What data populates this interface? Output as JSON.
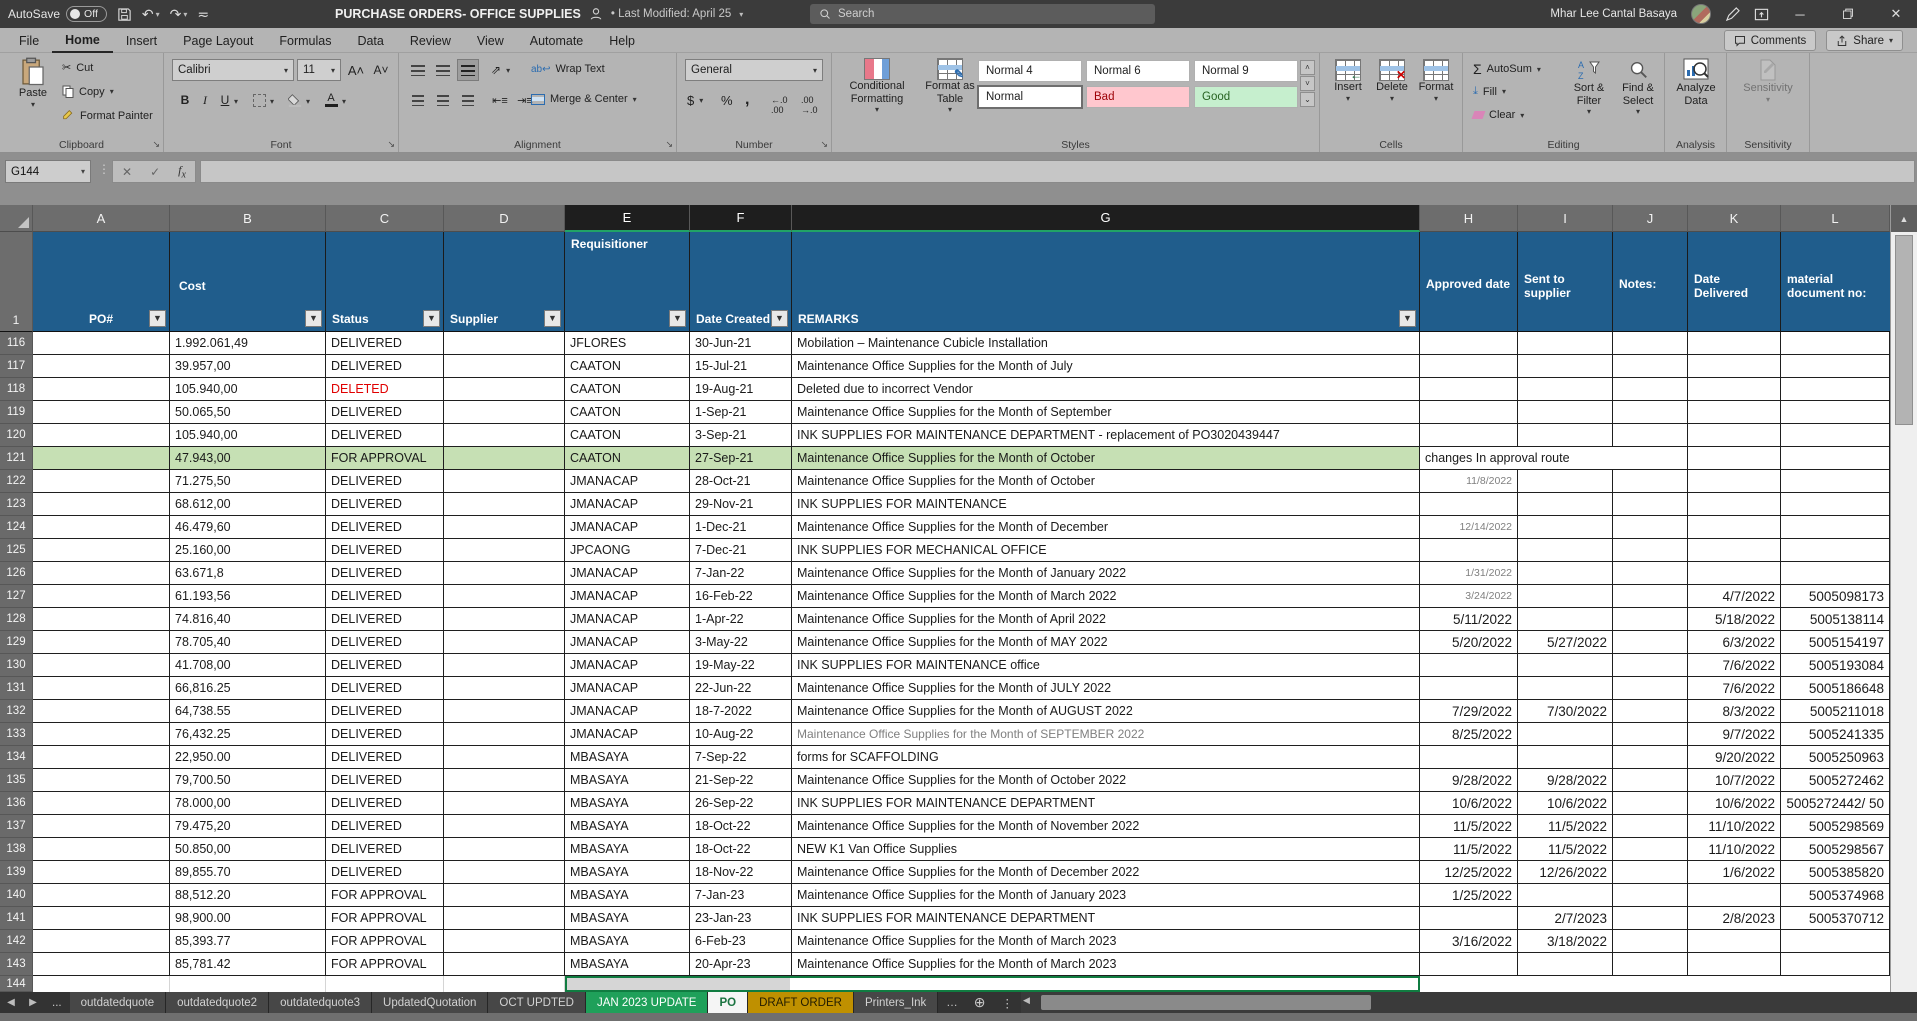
{
  "titlebar": {
    "autosave_label": "AutoSave",
    "autosave_state": "Off",
    "doc_title": "PURCHASE ORDERS- OFFICE SUPPLIES",
    "last_modified": "• Last Modified: April 25",
    "search_placeholder": "Search",
    "user_name": "Mhar Lee Cantal Basaya"
  },
  "icons": {
    "undo": "↶",
    "redo": "↷",
    "dropdown": "▾",
    "check": "✓",
    "close": "✕",
    "cut": "✂",
    "autosum": "Σ",
    "up": "▲",
    "ellipsis": "…",
    "add": "+",
    "more": "⋮",
    "left": "◀",
    "right": "▶"
  },
  "ribbon_tabs": {
    "items": [
      "File",
      "Home",
      "Insert",
      "Page Layout",
      "Formulas",
      "Data",
      "Review",
      "View",
      "Automate",
      "Help"
    ],
    "active": "Home",
    "comments": "Comments",
    "share": "Share"
  },
  "ribbon": {
    "clipboard": {
      "group": "Clipboard",
      "paste": "Paste",
      "cut": "Cut",
      "copy": "Copy",
      "format_painter": "Format Painter"
    },
    "font": {
      "group": "Font",
      "name": "Calibri",
      "size": "11"
    },
    "alignment": {
      "group": "Alignment",
      "wrap": "Wrap Text",
      "merge": "Merge & Center"
    },
    "number": {
      "group": "Number",
      "format": "General"
    },
    "styles": {
      "group": "Styles",
      "conditional": "Conditional\nFormatting",
      "format_table": "Format as\nTable",
      "chips": [
        {
          "label": "Normal 4",
          "type": "plain"
        },
        {
          "label": "Normal 6",
          "type": "plain"
        },
        {
          "label": "Normal 9",
          "type": "plain"
        },
        {
          "label": "Normal",
          "type": "selected"
        },
        {
          "label": "Bad",
          "type": "bad"
        },
        {
          "label": "Good",
          "type": "good"
        }
      ]
    },
    "cells": {
      "group": "Cells",
      "insert": "Insert",
      "delete": "Delete",
      "format": "Format"
    },
    "editing": {
      "group": "Editing",
      "autosum": "AutoSum",
      "fill": "Fill",
      "clear": "Clear",
      "sort": "Sort &\nFilter",
      "find": "Find &\nSelect"
    },
    "analysis": {
      "group": "Analysis",
      "analyze": "Analyze\nData"
    },
    "sensitivity": {
      "group": "Sensitivity",
      "button": "Sensitivity"
    }
  },
  "formula_bar": {
    "name_box": "G144",
    "formula": ""
  },
  "grid": {
    "columns": [
      "A",
      "B",
      "C",
      "D",
      "E",
      "F",
      "G",
      "H",
      "I",
      "J",
      "K",
      "L"
    ],
    "selected_columns": [
      "E",
      "F",
      "G"
    ],
    "header": {
      "po": "PO#",
      "cost": "Cost",
      "status": "Status",
      "supplier": "Supplier",
      "requisitioner": "Requisitioner",
      "date_created": "Date Created",
      "remarks": "REMARKS",
      "approved": "Approved date",
      "sent": "Sent to supplier",
      "notes": "Notes:",
      "delivered": "Date Delivered",
      "material": "material document no:"
    },
    "bottom_row_number": "144",
    "rows": [
      {
        "n": "116",
        "cost": "1.992.061,49",
        "status": "DELIVERED",
        "req": "JFLORES",
        "dc": "30-Jun-21",
        "rem": "Mobilation – Maintenance Cubicle Installation"
      },
      {
        "n": "117",
        "cost": "39.957,00",
        "status": "DELIVERED",
        "req": "CAATON",
        "dc": "15-Jul-21",
        "rem": "Maintenance Office Supplies for the Month of July"
      },
      {
        "n": "118",
        "cost": "105.940,00",
        "status": "DELETED",
        "red": true,
        "req": "CAATON",
        "dc": "19-Aug-21",
        "rem": "Deleted due to incorrect Vendor"
      },
      {
        "n": "119",
        "cost": "50.065,50",
        "status": "DELIVERED",
        "req": "CAATON",
        "dc": "1-Sep-21",
        "rem": "Maintenance Office Supplies for the Month of September"
      },
      {
        "n": "120",
        "cost": "105.940,00",
        "status": "DELIVERED",
        "req": "CAATON",
        "dc": "3-Sep-21",
        "rem": "INK SUPPLIES FOR MAINTENANCE DEPARTMENT - replacement of PO3020439447"
      },
      {
        "n": "121",
        "cost": "47.943,00",
        "status": "FOR APPROVAL",
        "req": "CAATON",
        "dc": "27-Sep-21",
        "rem": "Maintenance Office Supplies for the Month of October",
        "green": true,
        "note": "changes In approval route"
      },
      {
        "n": "122",
        "cost": "71.275,50",
        "status": "DELIVERED",
        "req": "JMANACAP",
        "dc": "28-Oct-21",
        "rem": "Maintenance Office Supplies for the Month of October",
        "h": "11/8/2022",
        "h_small": true
      },
      {
        "n": "123",
        "cost": "68.612,00",
        "status": "DELIVERED",
        "req": "JMANACAP",
        "dc": "29-Nov-21",
        "rem": "INK SUPPLIES FOR MAINTENANCE"
      },
      {
        "n": "124",
        "cost": "46.479,60",
        "status": "DELIVERED",
        "req": "JMANACAP",
        "dc": "1-Dec-21",
        "rem": "Maintenance Office Supplies for the Month of December",
        "h": "12/14/2022",
        "h_small": true
      },
      {
        "n": "125",
        "cost": "25.160,00",
        "status": "DELIVERED",
        "req": "JPCAONG",
        "dc": "7-Dec-21",
        "rem": "INK SUPPLIES FOR MECHANICAL OFFICE"
      },
      {
        "n": "126",
        "cost": "63.671,8",
        "status": "DELIVERED",
        "req": "JMANACAP",
        "dc": "7-Jan-22",
        "rem": "Maintenance Office Supplies for the Month of January 2022",
        "h": "1/31/2022",
        "h_small": true
      },
      {
        "n": "127",
        "cost": "61.193,56",
        "status": "DELIVERED",
        "req": "JMANACAP",
        "dc": "16-Feb-22",
        "rem": "Maintenance Office Supplies for the Month of March 2022",
        "h": "3/24/2022",
        "h_small": true,
        "k": "4/7/2022",
        "l": "5005098173"
      },
      {
        "n": "128",
        "cost": "74.816,40",
        "status": "DELIVERED",
        "req": "JMANACAP",
        "dc": "1-Apr-22",
        "rem": "Maintenance Office Supplies for the Month of April 2022",
        "h": "5/11/2022",
        "k": "5/18/2022",
        "l": "5005138114"
      },
      {
        "n": "129",
        "cost": "78.705,40",
        "status": "DELIVERED",
        "req": "JMANACAP",
        "dc": "3-May-22",
        "rem": "Maintenance Office Supplies for the Month of MAY 2022",
        "h": "5/20/2022",
        "i": "5/27/2022",
        "k": "6/3/2022",
        "l": "5005154197"
      },
      {
        "n": "130",
        "cost": "41.708,00",
        "status": "DELIVERED",
        "req": "JMANACAP",
        "dc": "19-May-22",
        "rem": "INK SUPPLIES FOR MAINTENANCE office",
        "k": "7/6/2022",
        "l": "5005193084"
      },
      {
        "n": "131",
        "cost": "66,816.25",
        "status": "DELIVERED",
        "req": "JMANACAP",
        "dc": "22-Jun-22",
        "rem": "Maintenance Office Supplies for the Month of JULY 2022",
        "k": "7/6/2022",
        "l": "5005186648"
      },
      {
        "n": "132",
        "cost": "64,738.55",
        "status": "DELIVERED",
        "req": "JMANACAP",
        "dc": "18-7-2022",
        "rem": "Maintenance Office Supplies for the Month of AUGUST 2022",
        "h": "7/29/2022",
        "i": "7/30/2022",
        "k": "8/3/2022",
        "l": "5005211018"
      },
      {
        "n": "133",
        "cost": "76,432.25",
        "status": "DELIVERED",
        "req": "JMANACAP",
        "dc": "10-Aug-22",
        "rem": "Maintenance Office Supplies for the Month of SEPTEMBER 2022",
        "gray_rem": true,
        "h": "8/25/2022",
        "k": "9/7/2022",
        "l": "5005241335"
      },
      {
        "n": "134",
        "cost": "22,950.00",
        "status": "DELIVERED",
        "req": "MBASAYA",
        "dc": "7-Sep-22",
        "rem": "forms for SCAFFOLDING",
        "k": "9/20/2022",
        "l": "5005250963"
      },
      {
        "n": "135",
        "cost": "79,700.50",
        "status": "DELIVERED",
        "req": "MBASAYA",
        "dc": "21-Sep-22",
        "rem": "Maintenance Office Supplies for the Month of October 2022",
        "h": "9/28/2022",
        "i": "9/28/2022",
        "k": "10/7/2022",
        "l": "5005272462"
      },
      {
        "n": "136",
        "cost": "78.000,00",
        "status": "DELIVERED",
        "req": "MBASAYA",
        "dc": "26-Sep-22",
        "rem": "INK SUPPLIES FOR MAINTENANCE DEPARTMENT",
        "h": "10/6/2022",
        "i": "10/6/2022",
        "k": "10/6/2022",
        "l": "5005272442/ 50"
      },
      {
        "n": "137",
        "cost": "79.475,20",
        "status": "DELIVERED",
        "req": "MBASAYA",
        "dc": "18-Oct-22",
        "rem": "Maintenance Office Supplies for the Month of November 2022",
        "h": "11/5/2022",
        "i": "11/5/2022",
        "k": "11/10/2022",
        "l": "5005298569"
      },
      {
        "n": "138",
        "cost": "50.850,00",
        "status": "DELIVERED",
        "req": "MBASAYA",
        "dc": "18-Oct-22",
        "rem": "NEW K1 Van Office Supplies",
        "h": "11/5/2022",
        "i": "11/5/2022",
        "k": "11/10/2022",
        "l": "5005298567"
      },
      {
        "n": "139",
        "cost": "89,855.70",
        "status": "DELIVERED",
        "req": "MBASAYA",
        "dc": "18-Nov-22",
        "rem": "Maintenance Office Supplies for the Month of December 2022",
        "h": "12/25/2022",
        "i": "12/26/2022",
        "k": "1/6/2022",
        "l": "5005385820"
      },
      {
        "n": "140",
        "cost": "88,512.20",
        "status": "FOR APPROVAL",
        "req": "MBASAYA",
        "dc": "7-Jan-23",
        "rem": "Maintenance Office Supplies for the Month of January 2023",
        "h": "1/25/2022",
        "l": "5005374968"
      },
      {
        "n": "141",
        "cost": "98,900.00",
        "status": "FOR APPROVAL",
        "req": "MBASAYA",
        "dc": "23-Jan-23",
        "rem": "INK SUPPLIES FOR MAINTENANCE DEPARTMENT",
        "i": "2/7/2023",
        "k": "2/8/2023",
        "l": "5005370712"
      },
      {
        "n": "142",
        "cost": "85,393.77",
        "status": "FOR APPROVAL",
        "req": "MBASAYA",
        "dc": "6-Feb-23",
        "rem": "Maintenance Office Supplies for the Month of March 2023",
        "h": "3/16/2022",
        "i": "3/18/2022"
      },
      {
        "n": "143",
        "cost": "85,781.42",
        "status": "FOR APPROVAL",
        "req": "MBASAYA",
        "dc": "20-Apr-23",
        "rem": "Maintenance Office Supplies for the Month of March 2023"
      }
    ]
  },
  "sheet_tabs": {
    "overflow": "...",
    "tabs": [
      {
        "label": "outdatedquote",
        "type": "normal"
      },
      {
        "label": "outdatedquote2",
        "type": "normal"
      },
      {
        "label": "outdatedquote3",
        "type": "normal"
      },
      {
        "label": "UpdatedQuotation",
        "type": "normal"
      },
      {
        "label": "OCT UPDTED",
        "type": "normal"
      },
      {
        "label": "JAN 2023 UPDATE",
        "type": "green"
      },
      {
        "label": "PO",
        "type": "active"
      },
      {
        "label": "DRAFT ORDER",
        "type": "gold"
      },
      {
        "label": "Printers_Ink",
        "type": "normal"
      }
    ]
  },
  "colors": {
    "header_blue": "#205d8c",
    "row_highlight": "#c6e0b4",
    "deleted_red": "#e00000",
    "accent_green": "#21a366",
    "tab_green": "#1fa05a",
    "tab_gold": "#bf9000",
    "selection_green": "#107c41"
  }
}
